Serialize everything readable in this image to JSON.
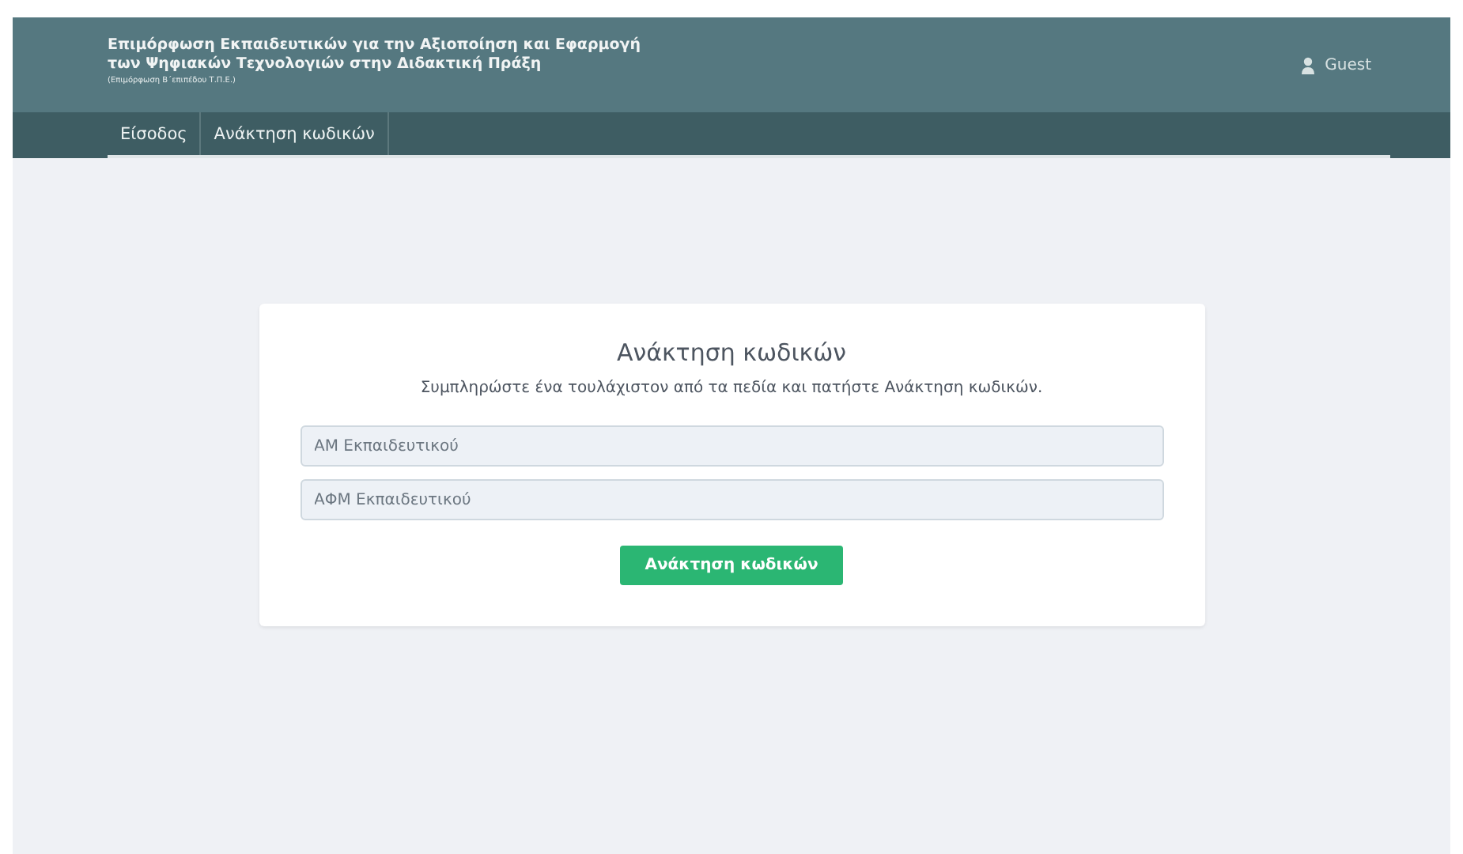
{
  "header": {
    "title_lines": [
      "Επιμόρφωση Εκπαιδευτικών για την Αξιοποίηση και Εφαρμογή",
      "των Ψηφιακών Τεχνολογιών στην Διδακτική Πράξη"
    ],
    "subtitle": "(Επιμόρφωση Β΄επιπέδου Τ.Π.Ε.)",
    "user": "Guest"
  },
  "nav": [
    {
      "label": "Είσοδος"
    },
    {
      "label": "Ανάκτηση κωδικών"
    }
  ],
  "card": {
    "title": "Ανάκτηση κωδικών",
    "instructions": "Συμπληρώστε ένα τουλάχιστον από τα πεδία και πατήστε Ανάκτηση κωδικών.",
    "fields": [
      {
        "placeholder": "ΑΜ Εκπαιδευτικού"
      },
      {
        "placeholder": "ΑΦΜ Εκπαιδευτικού"
      }
    ],
    "button": "Ανάκτηση κωδικών"
  }
}
